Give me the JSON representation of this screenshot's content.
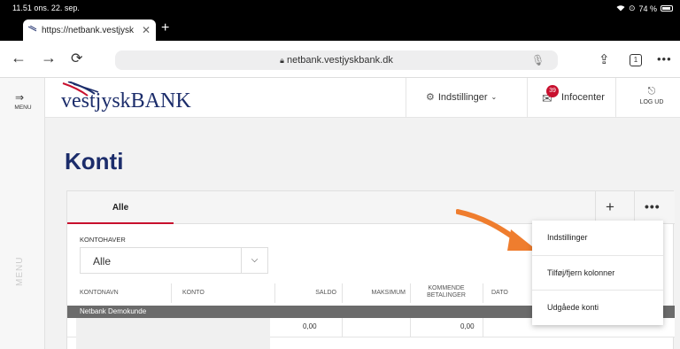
{
  "status": {
    "time": "11.51",
    "date": "ons. 22. sep.",
    "battery": "74 %"
  },
  "browser": {
    "tab_title": "https://netbank.vestjysk",
    "url": "netbank.vestjyskbank.dk",
    "tabs_count": "1"
  },
  "sidebar": {
    "menu_label": "MENU",
    "vertical_label": "MENU"
  },
  "header": {
    "logo_text": "vestjyskBANK",
    "settings_label": "Indstillinger",
    "infocenter_label": "Infocenter",
    "infocenter_badge": "39",
    "logout_label": "LOG UD"
  },
  "page": {
    "title": "Konti"
  },
  "panel": {
    "tab_all": "Alle",
    "owner_label": "KONTOHAVER",
    "owner_value": "Alle",
    "columns": {
      "name": "KONTONAVN",
      "account": "KONTO",
      "balance": "SALDO",
      "max": "MAKSIMUM",
      "upcoming_line1": "KOMMENDE",
      "upcoming_line2": "BETALINGER",
      "date": "DATO"
    },
    "group_label": "Netbank Demokunde",
    "rows": [
      {
        "balance": "0,00",
        "upcoming": "0,00"
      }
    ]
  },
  "dropdown": {
    "items": [
      "Indstillinger",
      "Tilføj/fjern kolonner",
      "Udgåede konti"
    ]
  },
  "colors": {
    "brand_blue": "#1c2d6b",
    "accent_red": "#c8102e",
    "arrow_orange": "#ef7d2e"
  }
}
